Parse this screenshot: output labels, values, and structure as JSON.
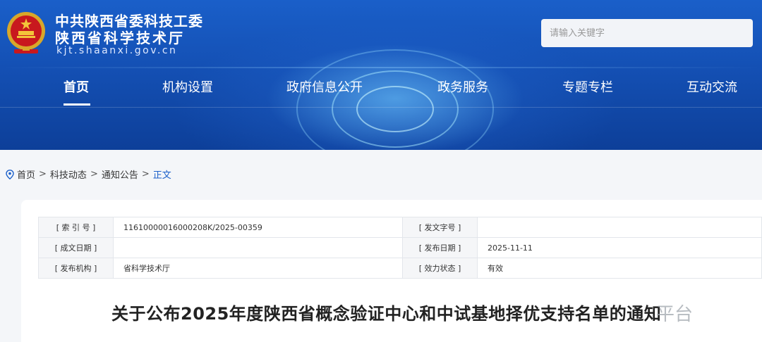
{
  "header": {
    "site_name_line1": "中共陕西省委科技工委",
    "site_name_line2": "陕西省科学技术厅",
    "site_url": "kjt.shaanxi.gov.cn",
    "search_placeholder": "请输入关键字",
    "emblem_icon": "national-emblem-icon"
  },
  "nav": {
    "items": [
      {
        "label": "首页",
        "active": true
      },
      {
        "label": "机构设置"
      },
      {
        "label": "政府信息公开"
      },
      {
        "label": "政务服务"
      },
      {
        "label": "专题专栏"
      },
      {
        "label": "互动交流"
      }
    ]
  },
  "breadcrumb": {
    "icon": "location-pin-icon",
    "items": [
      "首页",
      "科技动态",
      "通知公告",
      "正文"
    ],
    "separator": ">"
  },
  "info": {
    "index_label": "[ 索 引 号 ]",
    "index_value": "11610000016000208K/2025-00359",
    "doc_no_label": "[ 发文字号 ]",
    "doc_no_value": "",
    "created_label": "[ 成文日期 ]",
    "created_value": "",
    "published_label": "[ 发布日期 ]",
    "published_value": "2025-11-11",
    "org_label": "[ 发布机构 ]",
    "org_value": "省科学技术厅",
    "status_label": "[ 效力状态 ]",
    "status_value": "有效"
  },
  "article": {
    "title": "关于公布2025年度陕西省概念验证中心和中试基地择优支持名单的通知"
  },
  "watermark": "平台",
  "colors": {
    "header_blue": "#1a5fc9",
    "link_blue": "#1a5fc9",
    "status_green": "#2e8b2e"
  }
}
